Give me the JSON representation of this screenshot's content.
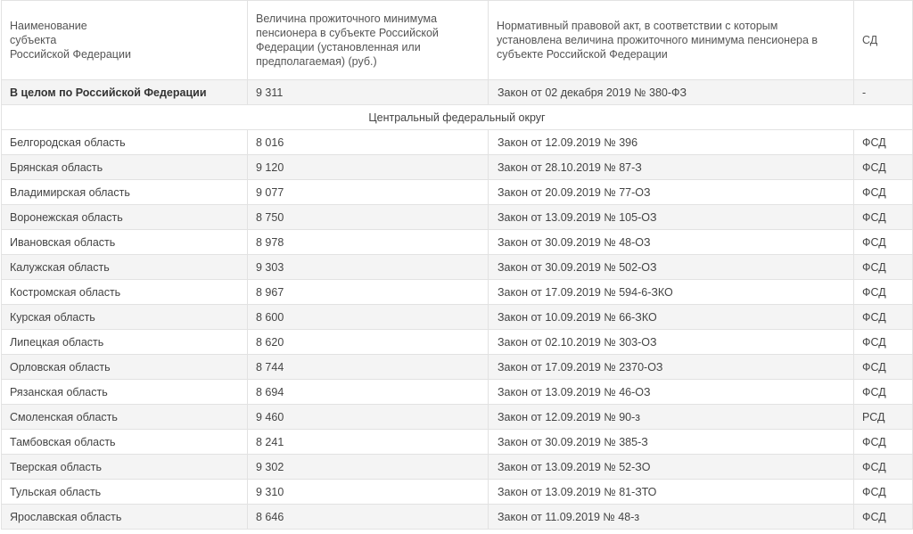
{
  "header": {
    "col1": "Наименование\nсубъекта\nРоссийской Федерации",
    "col2": "Величина прожиточного минимума пенсионера в субъекте Российской Федерации (установленная или предполагаемая) (руб.)",
    "col3": "Нормативный правовой акт, в соответствии с которым установлена величина прожиточного минимума пенсионера в субъекте Российской Федерации",
    "col4": "СД"
  },
  "total": {
    "name": "В целом по Российской Федерации",
    "value": "9 311",
    "law": "Закон от 02 декабря 2019 № 380-ФЗ",
    "sd": "-"
  },
  "section": "Центральный федеральный округ",
  "rows": [
    {
      "name": "Белгородская область",
      "value": "8 016",
      "law": "Закон от 12.09.2019 № 396",
      "sd": "ФСД"
    },
    {
      "name": "Брянская область",
      "value": "9 120",
      "law": "Закон от 28.10.2019 № 87-З",
      "sd": "ФСД"
    },
    {
      "name": "Владимирская область",
      "value": "9 077",
      "law": "Закон от 20.09.2019 № 77-ОЗ",
      "sd": "ФСД"
    },
    {
      "name": "Воронежская область",
      "value": "8 750",
      "law": "Закон от 13.09.2019 № 105-ОЗ",
      "sd": "ФСД"
    },
    {
      "name": "Ивановская область",
      "value": "8 978",
      "law": "Закон от 30.09.2019 № 48-ОЗ",
      "sd": "ФСД"
    },
    {
      "name": "Калужская область",
      "value": "9 303",
      "law": "Закон от 30.09.2019 № 502-ОЗ",
      "sd": "ФСД"
    },
    {
      "name": "Костромская область",
      "value": "8 967",
      "law": "Закон от 17.09.2019 № 594-6-ЗКО",
      "sd": "ФСД"
    },
    {
      "name": "Курская область",
      "value": "8 600",
      "law": "Закон от 10.09.2019 № 66-ЗКО",
      "sd": "ФСД"
    },
    {
      "name": "Липецкая область",
      "value": "8 620",
      "law": "Закон от 02.10.2019 № 303-ОЗ",
      "sd": "ФСД"
    },
    {
      "name": "Орловская область",
      "value": "8 744",
      "law": "Закон от 17.09.2019 № 2370-ОЗ",
      "sd": "ФСД"
    },
    {
      "name": "Рязанская область",
      "value": "8 694",
      "law": "Закон от 13.09.2019 № 46-ОЗ",
      "sd": "ФСД"
    },
    {
      "name": "Смоленская область",
      "value": "9 460",
      "law": "Закон от 12.09.2019 № 90-з",
      "sd": "РСД"
    },
    {
      "name": "Тамбовская область",
      "value": "8 241",
      "law": "Закон от 30.09.2019 № 385-З",
      "sd": "ФСД"
    },
    {
      "name": "Тверская область",
      "value": "9 302",
      "law": "Закон от 13.09.2019 № 52-ЗО",
      "sd": "ФСД"
    },
    {
      "name": "Тульская область",
      "value": "9 310",
      "law": "Закон от 13.09.2019 № 81-ЗТО",
      "sd": "ФСД"
    },
    {
      "name": "Ярославская область",
      "value": "8 646",
      "law": "Закон от 11.09.2019 № 48-з",
      "sd": "ФСД"
    }
  ]
}
